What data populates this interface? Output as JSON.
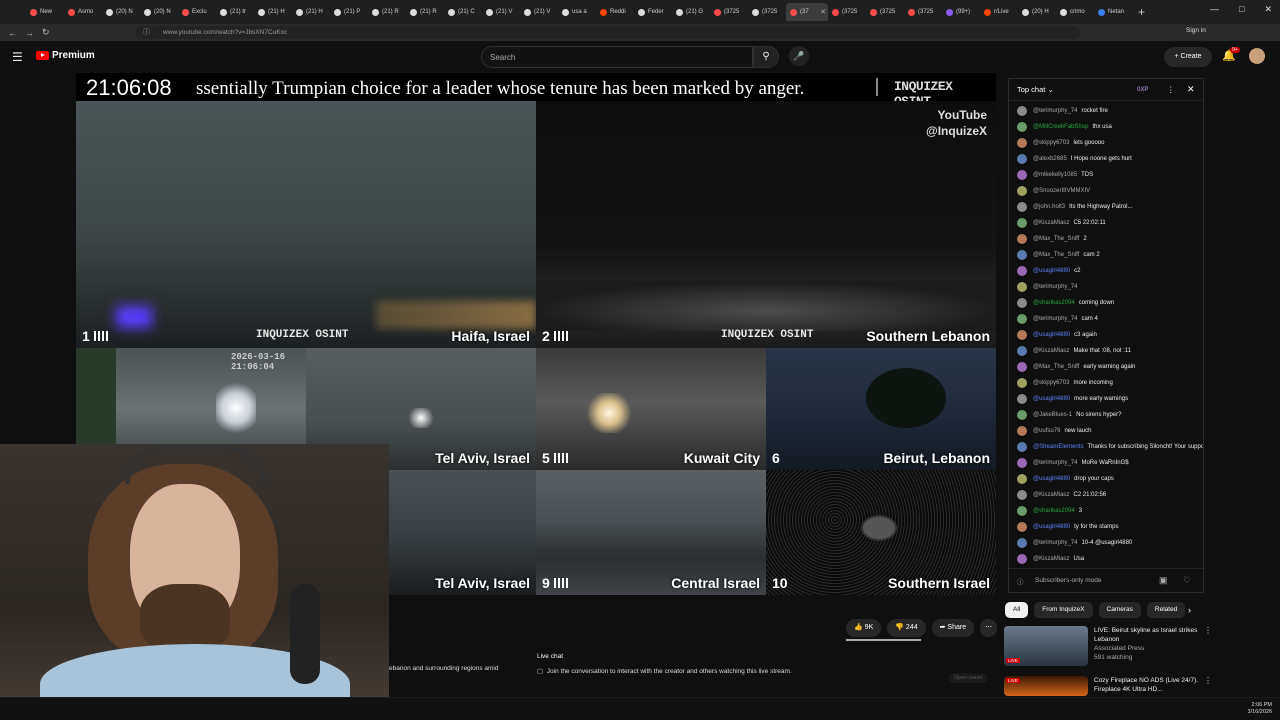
{
  "browser": {
    "tabs": [
      {
        "label": "New",
        "color": "#ff4b4b"
      },
      {
        "label": "Asmo",
        "color": "#ff4b4b"
      },
      {
        "label": "(20) N",
        "color": "#dddddd"
      },
      {
        "label": "(20) N",
        "color": "#dddddd"
      },
      {
        "label": "Exclu",
        "color": "#ff4b4b"
      },
      {
        "label": "(21) tr",
        "color": "#dddddd"
      },
      {
        "label": "(21) H",
        "color": "#dddddd"
      },
      {
        "label": "(21) H",
        "color": "#dddddd"
      },
      {
        "label": "(21) P",
        "color": "#dddddd"
      },
      {
        "label": "(21) R",
        "color": "#dddddd"
      },
      {
        "label": "(21) R",
        "color": "#dddddd"
      },
      {
        "label": "(21) C",
        "color": "#dddddd"
      },
      {
        "label": "(21) V",
        "color": "#dddddd"
      },
      {
        "label": "(21) V",
        "color": "#dddddd"
      },
      {
        "label": "usa a",
        "color": "#dddddd"
      },
      {
        "label": "Reddi",
        "color": "#ff4500"
      },
      {
        "label": "Feder",
        "color": "#dddddd"
      },
      {
        "label": "(21) G",
        "color": "#dddddd"
      },
      {
        "label": "(3725",
        "color": "#ff4b4b"
      },
      {
        "label": "(3725",
        "color": "#dddddd"
      },
      {
        "label": "(37",
        "color": "#ff4b4b"
      },
      {
        "label": "(3725",
        "color": "#ff4b4b"
      },
      {
        "label": "(3725",
        "color": "#ff4b4b"
      },
      {
        "label": "(3725",
        "color": "#ff4b4b"
      },
      {
        "label": "(99+)",
        "color": "#8b5cf6"
      },
      {
        "label": "r/Live",
        "color": "#ff4500"
      },
      {
        "label": "(20) H",
        "color": "#dddddd"
      },
      {
        "label": "crimo",
        "color": "#dddddd"
      },
      {
        "label": "Netan",
        "color": "#3b82f6"
      }
    ],
    "url": "www.youtube.com/watch?v=JbsXN7CuKxc",
    "signin": "Sign in"
  },
  "youtube": {
    "logo_text": "Premium",
    "search_placeholder": "Search",
    "create_label": "Create",
    "notif_count": "9+"
  },
  "stream": {
    "clock": "21:06:08",
    "ticker": "ssentially Trumpian choice for a leader whose tenure has been marked by anger.",
    "brand": "INQUIZEX OSINT",
    "yt_line1": "YouTube",
    "yt_line2": "@InquizeX",
    "cams": [
      {
        "num": "1",
        "label": "Haifa, Israel"
      },
      {
        "num": "2",
        "label": "Southern Lebanon"
      },
      {
        "num": "",
        "label": "Tel Aviv, Israel"
      },
      {
        "num": "5",
        "label": "Kuwait City"
      },
      {
        "num": "6",
        "label": "Beirut, Lebanon"
      },
      {
        "num": "",
        "label": "Tel Aviv, Israel"
      },
      {
        "num": "9",
        "label": "Central Israel"
      },
      {
        "num": "10",
        "label": "Southern Israel"
      }
    ],
    "cam_timestamp": "2026-03-16 21:06:04"
  },
  "below_video": {
    "description": "ebanon and surrounding regions amid",
    "likes": "9K",
    "dislikes": "244",
    "share": "Share",
    "live_chat_title": "Live chat",
    "live_chat_text": "Join the conversation to interact with the creator and others watching this live stream.",
    "open_panel": "Open panel"
  },
  "chat": {
    "header": "Top chat",
    "points": "0XP",
    "messages": [
      {
        "name": "@terimurphy_74",
        "text": "rocket fire",
        "type": "normal"
      },
      {
        "name": "@MillCreekFabShop",
        "text": "thx usa",
        "type": "member"
      },
      {
        "name": "@skippy6703",
        "text": "lets gooooo",
        "type": "normal"
      },
      {
        "name": "@alexb2685",
        "text": "I Hope noone gets hurt",
        "type": "normal"
      },
      {
        "name": "@mikekelly1085",
        "text": "TDS",
        "type": "normal"
      },
      {
        "name": "@SnoozerIIIVMMXIV",
        "text": "",
        "type": "normal"
      },
      {
        "name": "@john.holt3",
        "text": "Its the Highway Patrol...",
        "type": "normal"
      },
      {
        "name": "@KiszaMiasz",
        "text": "C5 22:02:11",
        "type": "normal"
      },
      {
        "name": "@Max_The_Sniff",
        "text": "2",
        "type": "normal"
      },
      {
        "name": "@Max_The_Sniff",
        "text": "cam 2",
        "type": "normal"
      },
      {
        "name": "@usagirl4880",
        "text": "c2",
        "type": "mod"
      },
      {
        "name": "@terimurphy_74",
        "text": "",
        "type": "normal"
      },
      {
        "name": "@sharikas2094",
        "text": "coming down",
        "type": "member"
      },
      {
        "name": "@terimurphy_74",
        "text": "cam 4",
        "type": "normal"
      },
      {
        "name": "@usagirl4880",
        "text": "c3 again",
        "type": "mod"
      },
      {
        "name": "@KiszaMiasz",
        "text": "Make that :08, not :11",
        "type": "normal"
      },
      {
        "name": "@Max_The_Sniff",
        "text": "early warning again",
        "type": "normal"
      },
      {
        "name": "@skippy6703",
        "text": "more incoming",
        "type": "normal"
      },
      {
        "name": "@usagirl4880",
        "text": "more early warnings",
        "type": "mod"
      },
      {
        "name": "@JakeBlues-1",
        "text": "No sirens hyper?",
        "type": "normal"
      },
      {
        "name": "@uufsu76",
        "text": "new lauch",
        "type": "normal"
      },
      {
        "name": "@StreamElements",
        "text": "Thanks for subscribing Siloncht! Your support is appreciated!",
        "type": "mod"
      },
      {
        "name": "@terimurphy_74",
        "text": "MoRe WaRnInG$",
        "type": "normal"
      },
      {
        "name": "@usagirl4880",
        "text": "drop your caps",
        "type": "mod"
      },
      {
        "name": "@KiszaMiasz",
        "text": "C2 21:02:56",
        "type": "normal"
      },
      {
        "name": "@sharikas2094",
        "text": "3",
        "type": "member"
      },
      {
        "name": "@usagirl4880",
        "text": "ty for the stamps",
        "type": "mod"
      },
      {
        "name": "@terimurphy_74",
        "text": "10-4 @usagirl4880",
        "type": "normal"
      },
      {
        "name": "@KiszaMiasz",
        "text": "Usa",
        "type": "normal"
      }
    ],
    "footer": "Subscribers-only mode"
  },
  "sidebar": {
    "chips": [
      "All",
      "From InquizeX",
      "Cameras",
      "Related"
    ],
    "recs": [
      {
        "title": "LIVE: Beirut skyline as Israel strikes Lebanon",
        "channel": "Associated Press",
        "meta": "591 watching",
        "badge": "LIVE"
      },
      {
        "title": "Cozy Fireplace NO ADS (Live 24/7). Fireplace 4K Ultra HD...",
        "channel": "",
        "meta": "",
        "badge": "LIVE"
      }
    ]
  },
  "taskbar": {
    "time": "2:06 PM",
    "date": "3/16/2026"
  },
  "colors": {
    "accent": "#ff0000",
    "member": "#2ba640",
    "mod": "#5e84f1"
  }
}
